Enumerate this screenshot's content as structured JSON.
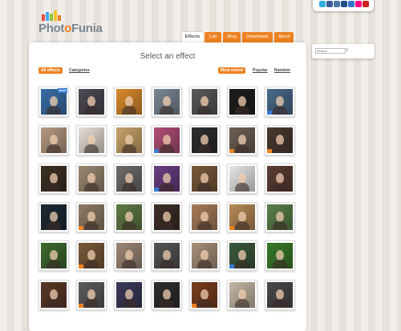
{
  "brand": {
    "name_part1": "Phot",
    "name_accent": "o",
    "name_part2": "Funia"
  },
  "social_icons": [
    {
      "name": "twitter-icon",
      "color": "#33aadd"
    },
    {
      "name": "facebook-icon",
      "color": "#3b5998"
    },
    {
      "name": "vkontakte-icon",
      "color": "#4c75a3"
    },
    {
      "name": "livejournal-icon",
      "color": "#1e4f86"
    },
    {
      "name": "delicious-icon",
      "color": "#3377cc"
    },
    {
      "name": "flickr-icon",
      "color": "#ff0084"
    },
    {
      "name": "youtube-icon",
      "color": "#cc2222"
    }
  ],
  "nav": {
    "tabs": [
      {
        "label": "Effects",
        "active": true
      },
      {
        "label": "Lab",
        "active": false
      },
      {
        "label": "Blog",
        "active": false
      },
      {
        "label": "Downloads",
        "active": false
      },
      {
        "label": "About",
        "active": false
      }
    ]
  },
  "search": {
    "placeholder": "Search"
  },
  "main": {
    "title": "Select an effect",
    "filters": {
      "all_effects": "All effects",
      "categories": "Categories"
    },
    "sort": {
      "most_recent": "Most recent",
      "popular": "Popular",
      "random": "Random"
    }
  },
  "effects_grid": {
    "rows": [
      [
        {
          "bg": "#3a6fa8",
          "new": true,
          "new_label": "New!"
        },
        {
          "bg": "#4d4a55"
        },
        {
          "bg": "#d98a2c"
        },
        {
          "bg": "#7a8896"
        },
        {
          "bg": "#5a5a5a"
        },
        {
          "bg": "#1e1e1e"
        },
        {
          "bg": "#4a6a8a",
          "flag": "#3a7bd5"
        },
        {
          "bg": "#b2302c"
        }
      ],
      [
        {
          "bg": "#b69a82"
        },
        {
          "bg": "#e6dfd6"
        },
        {
          "bg": "#c9a36a"
        },
        {
          "bg": "#b14e78",
          "flag": "#3a7bd5"
        },
        {
          "bg": "#2e2e2e"
        },
        {
          "bg": "#6f6055",
          "flag": "#ee8221"
        },
        {
          "bg": "#4a3a30",
          "flag": "#ee8221"
        }
      ],
      [
        {
          "bg": "#3e3024"
        },
        {
          "bg": "#9b8872"
        },
        {
          "bg": "#6e6c6a"
        },
        {
          "bg": "#6a3e82",
          "flag": "#3a7bd5"
        },
        {
          "bg": "#7a5a3a"
        },
        {
          "bg": "#e8e8e8"
        },
        {
          "bg": "#5c3e34"
        }
      ],
      [
        {
          "bg": "#1e2a36"
        },
        {
          "bg": "#8f7c66",
          "flag": "#ee8221"
        },
        {
          "bg": "#5f7a45"
        },
        {
          "bg": "#3e2e28"
        },
        {
          "bg": "#a87c5a"
        },
        {
          "bg": "#b78a56",
          "flag": "#ee8221"
        },
        {
          "bg": "#59804a"
        }
      ],
      [
        {
          "bg": "#3f6a30"
        },
        {
          "bg": "#7a5a3a",
          "flag": "#ee8221"
        },
        {
          "bg": "#9d8878"
        },
        {
          "bg": "#555555"
        },
        {
          "bg": "#a8907a"
        },
        {
          "bg": "#3c5a3c",
          "flag": "#3a7bd5"
        },
        {
          "bg": "#3a7a2a"
        }
      ],
      [
        {
          "bg": "#5a3a28"
        },
        {
          "bg": "#5c5c5c",
          "flag": "#ee8221"
        },
        {
          "bg": "#3a3a5a"
        },
        {
          "bg": "#2e2e2e"
        },
        {
          "bg": "#7a3e1e",
          "flag": "#ee8221"
        },
        {
          "bg": "#c4b8a4"
        },
        {
          "bg": "#4a4a4a"
        }
      ]
    ]
  }
}
